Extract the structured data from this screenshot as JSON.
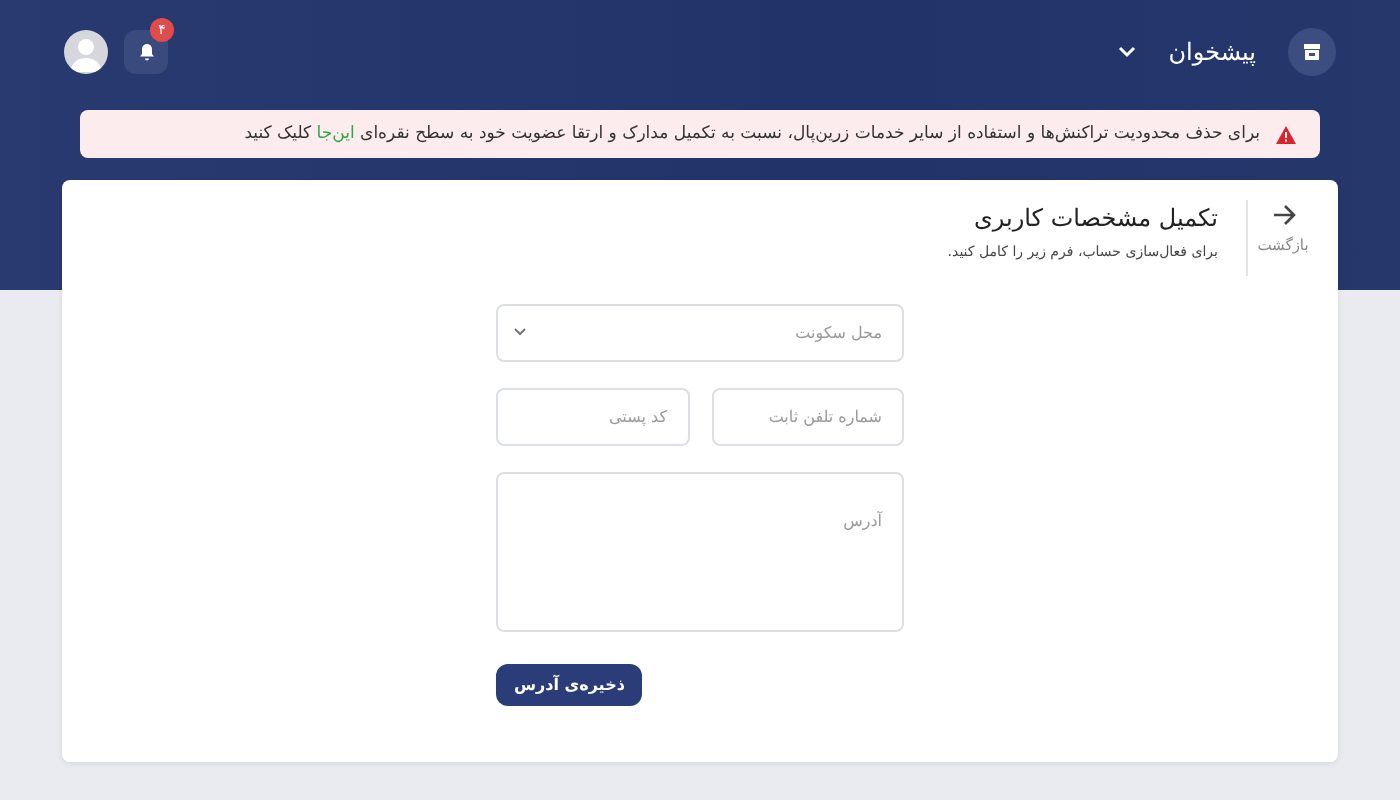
{
  "header": {
    "title": "پیشخوان",
    "notifications": "۴"
  },
  "alert": {
    "text": "برای حذف محدودیت تراکنش‌ها و استفاده از سایر خدمات زرین‌پال، نسبت به تکمیل مدارک و ارتقا عضویت خود به سطح نقره‌ای",
    "link": "این‌جا",
    "after": "کلیک کنید"
  },
  "card": {
    "back": "بازگشت",
    "title": "تکمیل مشخصات کاربری",
    "subtitle": "برای فعال‌سازی حساب، فرم زیر را کامل کنید."
  },
  "form": {
    "residence": {
      "placeholder": "محل سکونت"
    },
    "phone": {
      "placeholder": "شماره تلفن ثابت"
    },
    "postal_code": {
      "placeholder": "کد پستی"
    },
    "address": {
      "placeholder": "آدرس"
    },
    "submit": "ذخیره‌ی آدرس"
  }
}
